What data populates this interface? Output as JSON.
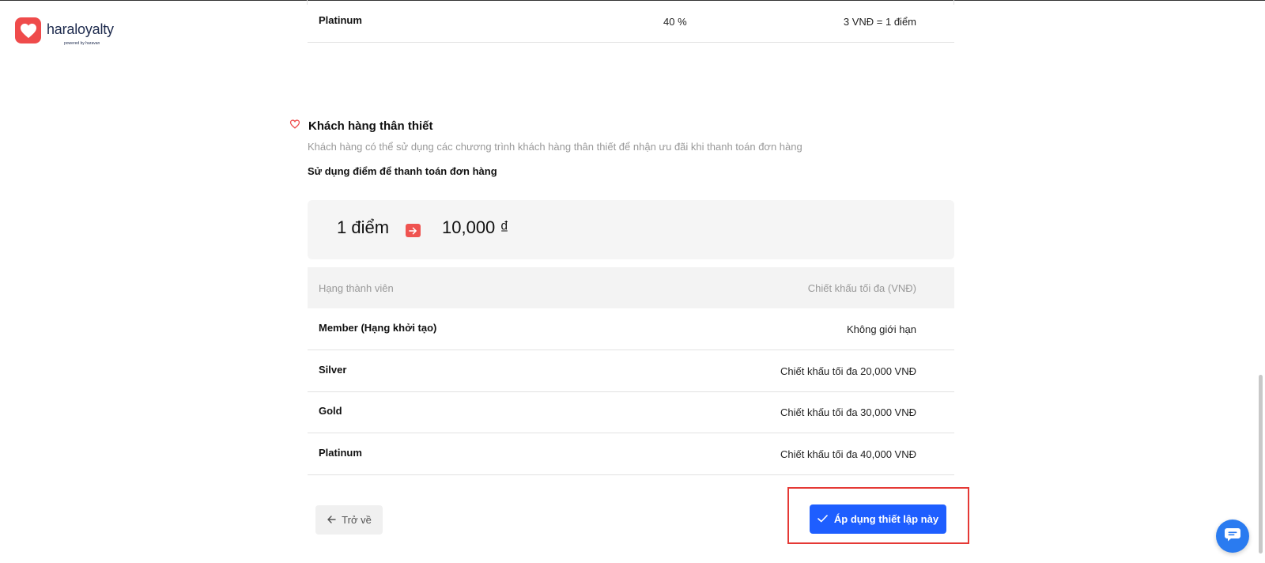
{
  "brand": {
    "name": "haraloyalty",
    "powered": "powered by haravan",
    "accent": "#ef4b4b"
  },
  "top_table": {
    "row": {
      "name": "Platinum",
      "percent": "40 %",
      "rate": "3 VNĐ = 1 điểm"
    }
  },
  "loyalty": {
    "icon": "heart-outline-icon",
    "title": "Khách hàng thân thiết",
    "description": "Khách hàng có thể sử dụng các chương trình khách hàng thân thiết để nhận ưu đãi khi thanh toán đơn hàng",
    "subtitle": "Sử dụng điểm để thanh toán đơn hàng",
    "conversion": {
      "points": "1 điểm",
      "value": "10,000 ₫",
      "arrow_icon": "arrow-right-icon"
    },
    "table": {
      "headers": [
        "Hạng thành viên",
        "Chiết khấu tối đa (VNĐ)"
      ],
      "rows": [
        {
          "tier": "Member (Hạng khởi tạo)",
          "discount": "Không giới hạn"
        },
        {
          "tier": "Silver",
          "discount": "Chiết khấu tối đa 20,000 VNĐ"
        },
        {
          "tier": "Gold",
          "discount": "Chiết khấu tối đa 30,000 VNĐ"
        },
        {
          "tier": "Platinum",
          "discount": "Chiết khấu tối đa 40,000 VNĐ"
        }
      ]
    }
  },
  "actions": {
    "back_label": "Trở về",
    "apply_label": "Áp dụng thiết lập này",
    "apply_color": "#1e5eff",
    "highlight_color": "#e53935"
  },
  "chat": {
    "icon": "chat-icon",
    "color": "#2a7bf0"
  }
}
